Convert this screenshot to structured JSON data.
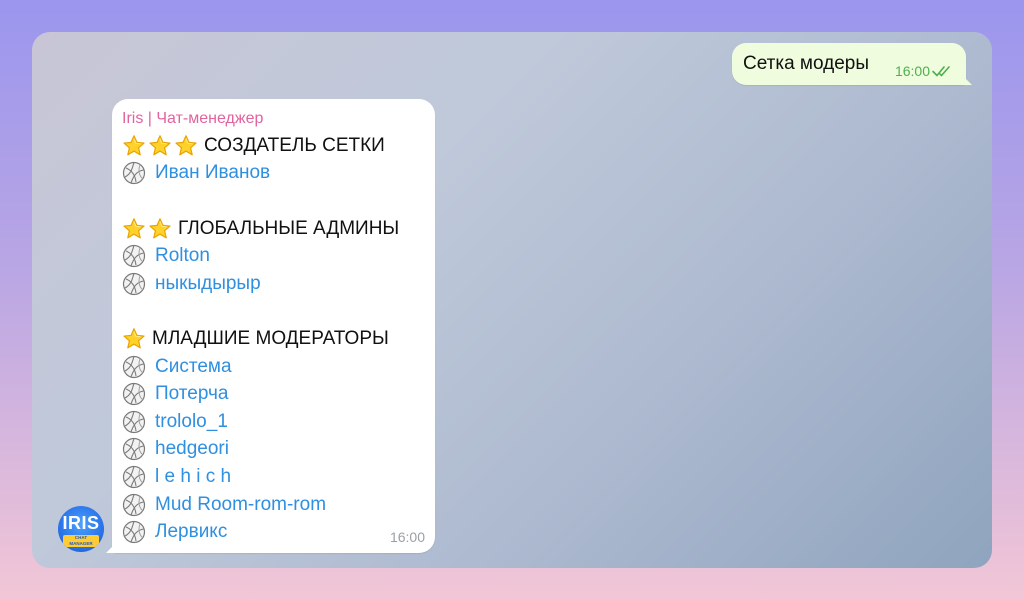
{
  "outgoing": {
    "text": "Сетка модеры",
    "time": "16:00"
  },
  "incoming": {
    "sender": "Iris | Чат-менеджер",
    "time": "16:00",
    "sections": [
      {
        "stars": 3,
        "title": "СОЗДАТЕЛЬ СЕТКИ",
        "members": [
          "Иван Иванов"
        ]
      },
      {
        "stars": 2,
        "title": "ГЛОБАЛЬНЫЕ АДМИНЫ",
        "members": [
          "Rolton",
          "ныкыдырыр"
        ]
      },
      {
        "stars": 1,
        "title": "МЛАДШИЕ МОДЕРАТОРЫ",
        "members": [
          "Система",
          "Потерча",
          "trololo_1",
          "hedgeori",
          "l e h i c h",
          "Mud Room-rom-rom",
          "Лервикс"
        ]
      }
    ]
  },
  "avatar": {
    "logo": "IRIS",
    "sub": "CHAT MANAGER"
  },
  "colors": {
    "sender": "#e2639e",
    "link": "#2f8fe0",
    "outgoing_bubble": "#effdde",
    "outgoing_meta": "#4fae4e"
  },
  "icons": {
    "star": "star-icon",
    "bullet": "volleyball-icon",
    "read": "double-check-icon"
  }
}
